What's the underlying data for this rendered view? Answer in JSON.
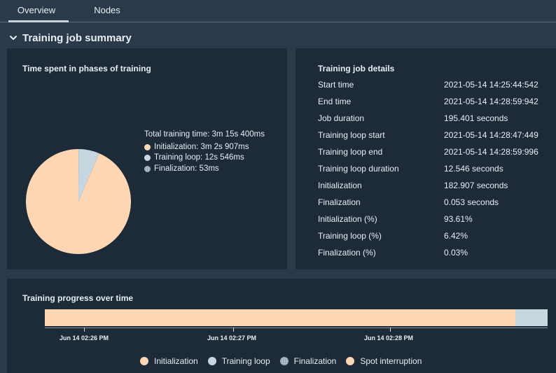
{
  "tabs": [
    {
      "label": "Overview"
    },
    {
      "label": "Nodes"
    }
  ],
  "section": {
    "title": "Training job summary"
  },
  "phases": {
    "title": "Time spent in phases of training",
    "total_label": "Total training time: 3m 15s 400ms",
    "legend": [
      {
        "label": "Initialization: 3m 2s 907ms",
        "color": "#fdd7b3"
      },
      {
        "label": "Training loop: 12s 546ms",
        "color": "#c8d6df"
      },
      {
        "label": "Finalization: 53ms",
        "color": "#b3c1cc"
      }
    ]
  },
  "chart_data": {
    "type": "pie",
    "title": "Time spent in phases of training",
    "labels": [
      "Initialization",
      "Training loop",
      "Finalization"
    ],
    "values": [
      93.61,
      6.42,
      0.03
    ],
    "colors": [
      "#fdd7b3",
      "#c8d6df",
      "#b3c1cc"
    ]
  },
  "details": {
    "title": "Training job details",
    "rows": [
      {
        "key": "Start time",
        "value": "2021-05-14 14:25:44:542"
      },
      {
        "key": "End time",
        "value": "2021-05-14 14:28:59:942"
      },
      {
        "key": "Job duration",
        "value": "195.401 seconds"
      },
      {
        "key": "Training loop start",
        "value": "2021-05-14 14:28:47:449"
      },
      {
        "key": "Training loop end",
        "value": "2021-05-14 14:28:59:996"
      },
      {
        "key": "Training loop duration",
        "value": "12.546 seconds"
      },
      {
        "key": "Initialization",
        "value": "182.907 seconds"
      },
      {
        "key": "Finalization",
        "value": "0.053 seconds"
      },
      {
        "key": "Initialization (%)",
        "value": "93.61%"
      },
      {
        "key": "Training loop (%)",
        "value": "6.42%"
      },
      {
        "key": "Finalization (%)",
        "value": "0.03%"
      }
    ]
  },
  "progress": {
    "title": "Training progress over time",
    "initialization_fraction": 0.936,
    "ticks": [
      {
        "label": "Jun 14 02:26 PM"
      },
      {
        "label": "Jun 14 02:27 PM"
      },
      {
        "label": "Jun 14 02:28 PM"
      }
    ],
    "legend": [
      {
        "label": "Initialization",
        "color": "#fdd7b3"
      },
      {
        "label": "Training loop",
        "color": "#c8d6df"
      },
      {
        "label": "Finalization",
        "color": "#b3c1cc"
      },
      {
        "label": "Spot interruption",
        "color": "#fdd7b3"
      }
    ]
  }
}
